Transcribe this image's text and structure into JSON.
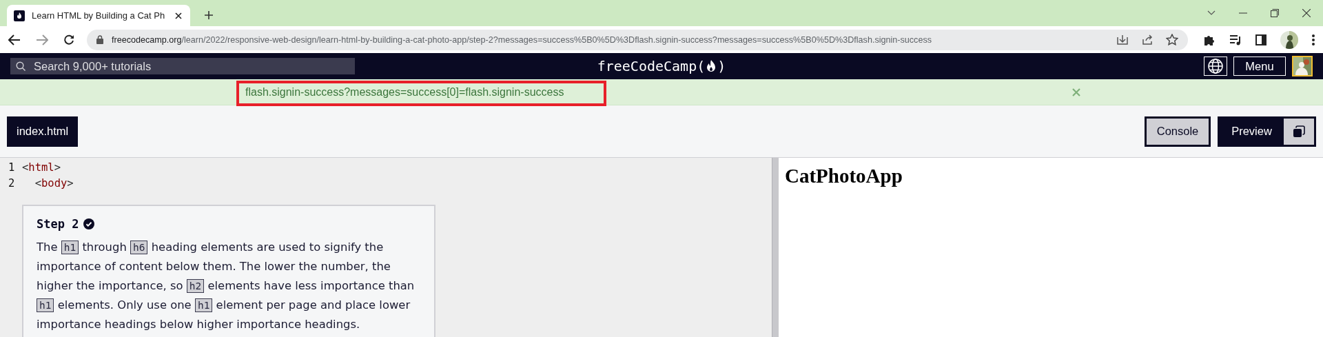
{
  "browser": {
    "tabs": [
      {
        "title": "Learn HTML by Building a Cat Ph",
        "selected": true
      }
    ],
    "url": {
      "host": "freecodecamp.org",
      "path": "/learn/2022/responsive-web-design/learn-html-by-building-a-cat-photo-app/step-2?messages=success%5B0%5D%3Dflash.signin-success?messages=success%5B0%5D%3Dflash.signin-success"
    },
    "forward_disabled": true
  },
  "nav": {
    "search": {
      "placeholder": "Search 9,000+ tutorials"
    },
    "logo": {
      "text": "freeCodeCamp",
      "open": "(",
      "close": ")"
    },
    "menu_button": "Menu"
  },
  "flash": {
    "message": "flash.signin-success?messages=success[0]=flash.signin-success",
    "highlighted": true
  },
  "toolbar": {
    "file_tabs": [
      {
        "label": "index.html",
        "selected": true
      }
    ],
    "buttons": [
      {
        "label": "Console",
        "kind": "toggle",
        "selected": false
      },
      {
        "label": "Preview",
        "kind": "split",
        "selected": true
      }
    ]
  },
  "editor": {
    "lines": [
      {
        "number": "1",
        "code": "<html>"
      },
      {
        "number": "2",
        "code": "  <body>"
      }
    ],
    "step": {
      "title": "Step 2",
      "completed": true,
      "paragraph": [
        {
          "kind": "text",
          "text": "The "
        },
        {
          "kind": "code",
          "text": "h1"
        },
        {
          "kind": "text",
          "text": " through "
        },
        {
          "kind": "code",
          "text": "h6"
        },
        {
          "kind": "text",
          "text": " heading elements are used to signify the importance of content below them. The lower the number, the higher the importance, so "
        },
        {
          "kind": "code",
          "text": "h2"
        },
        {
          "kind": "text",
          "text": " elements have less importance than "
        },
        {
          "kind": "code",
          "text": "h1"
        },
        {
          "kind": "text",
          "text": " elements. Only use one "
        },
        {
          "kind": "code",
          "text": "h1"
        },
        {
          "kind": "text",
          "text": " element per page and place lower importance headings below higher importance headings."
        }
      ]
    }
  },
  "preview": {
    "heading": "CatPhotoApp"
  }
}
